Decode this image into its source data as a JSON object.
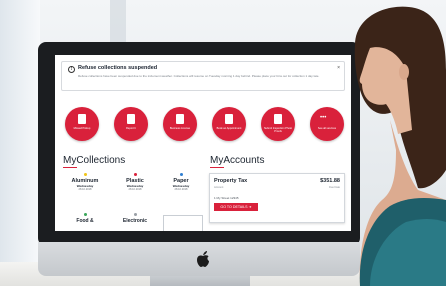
{
  "alert": {
    "title": "Refuse collections suspended",
    "text": "Refuse collections have been suspended due to the inclement weather. Collections will resume on Tuesday morning 1 day behind. Please place your bins out for collection 1 day late.",
    "close": "×"
  },
  "actions": [
    {
      "label": "Missed Pickup",
      "icon": "document-icon"
    },
    {
      "label": "Report It",
      "icon": "megaphone-icon"
    },
    {
      "label": "Business License",
      "icon": "document-icon"
    },
    {
      "label": "Book an Appointment",
      "icon": "document-icon"
    },
    {
      "label": "Submit Inspection Photo Proofs",
      "icon": "document-icon"
    },
    {
      "label": "See all services",
      "icon": "ellipsis-icon"
    }
  ],
  "collections": {
    "title": "MyCollections",
    "items": [
      {
        "name": "Aluminum",
        "day": "Wednesday",
        "date": "28.10.2018",
        "color": "#f0c419"
      },
      {
        "name": "Plastic",
        "day": "Wednesday",
        "date": "28.10.2018",
        "color": "#d9213b"
      },
      {
        "name": "Paper",
        "day": "Wednesday",
        "date": "28.10.2018",
        "color": "#2f7fd1"
      }
    ],
    "more": [
      {
        "name": "Food &",
        "color": "#3aa65a"
      },
      {
        "name": "Electronic",
        "color": "#9aa0a6"
      }
    ]
  },
  "accounts": {
    "title": "MyAccounts",
    "card": {
      "name": "Property Tax",
      "amount": "$351.88",
      "sub_left": "Account",
      "sub_right": "Due Date",
      "address": "1 My Street 12345",
      "button": "GO TO DETAILS ➜"
    }
  },
  "colors": {
    "accent": "#d9213b",
    "bezel": "#1b1d20"
  }
}
